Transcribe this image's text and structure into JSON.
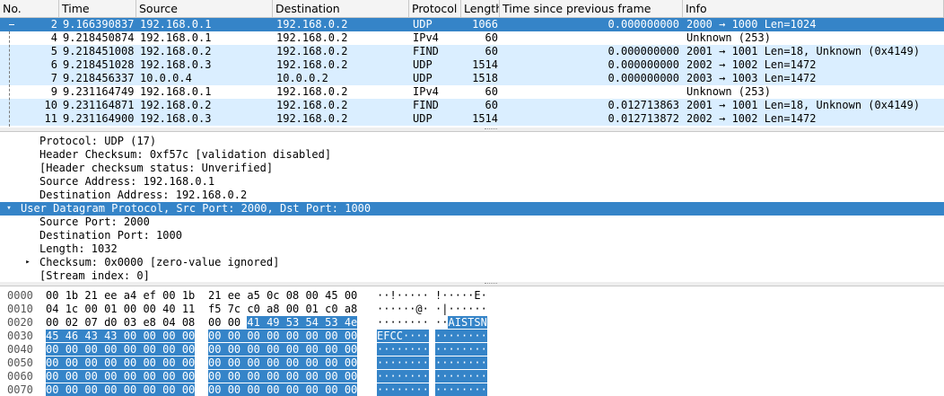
{
  "packet_list": {
    "columns": [
      "No.",
      "Time",
      "Source",
      "Destination",
      "Protocol",
      "Length",
      "Time since previous frame",
      "Info"
    ],
    "rows": [
      {
        "no": "2",
        "time": "9.166390837",
        "src": "192.168.0.1",
        "dst": "192.168.0.2",
        "proto": "UDP",
        "len": "1066",
        "delta": "0.000000000",
        "info": "2000 → 1000 Len=1024",
        "selected": true
      },
      {
        "no": "4",
        "time": "9.218450874",
        "src": "192.168.0.1",
        "dst": "192.168.0.2",
        "proto": "IPv4",
        "len": "60",
        "delta": "",
        "info": "Unknown (253)",
        "selected": false
      },
      {
        "no": "5",
        "time": "9.218451008",
        "src": "192.168.0.2",
        "dst": "192.168.0.2",
        "proto": "FIND",
        "len": "60",
        "delta": "0.000000000",
        "info": "2001 → 1001 Len=18, Unknown (0x4149)",
        "selected": false
      },
      {
        "no": "6",
        "time": "9.218451028",
        "src": "192.168.0.3",
        "dst": "192.168.0.2",
        "proto": "UDP",
        "len": "1514",
        "delta": "0.000000000",
        "info": "2002 → 1002 Len=1472",
        "selected": false
      },
      {
        "no": "7",
        "time": "9.218456337",
        "src": "10.0.0.4",
        "dst": "10.0.0.2",
        "proto": "UDP",
        "len": "1518",
        "delta": "0.000000000",
        "info": "2003 → 1003 Len=1472",
        "selected": false
      },
      {
        "no": "9",
        "time": "9.231164749",
        "src": "192.168.0.1",
        "dst": "192.168.0.2",
        "proto": "IPv4",
        "len": "60",
        "delta": "",
        "info": "Unknown (253)",
        "selected": false
      },
      {
        "no": "10",
        "time": "9.231164871",
        "src": "192.168.0.2",
        "dst": "192.168.0.2",
        "proto": "FIND",
        "len": "60",
        "delta": "0.012713863",
        "info": "2001 → 1001 Len=18, Unknown (0x4149)",
        "selected": false
      },
      {
        "no": "11",
        "time": "9.231164900",
        "src": "192.168.0.3",
        "dst": "192.168.0.2",
        "proto": "UDP",
        "len": "1514",
        "delta": "0.012713872",
        "info": "2002 → 1002 Len=1472",
        "selected": false
      }
    ]
  },
  "details": {
    "rows": [
      {
        "text": "Protocol: UDP (17)",
        "level": 1,
        "arrow": "",
        "selected": false
      },
      {
        "text": "Header Checksum: 0xf57c [validation disabled]",
        "level": 1,
        "arrow": "",
        "selected": false
      },
      {
        "text": "[Header checksum status: Unverified]",
        "level": 1,
        "arrow": "",
        "selected": false
      },
      {
        "text": "Source Address: 192.168.0.1",
        "level": 1,
        "arrow": "",
        "selected": false
      },
      {
        "text": "Destination Address: 192.168.0.2",
        "level": 1,
        "arrow": "",
        "selected": false
      },
      {
        "text": "User Datagram Protocol, Src Port: 2000, Dst Port: 1000",
        "level": 0,
        "arrow": "▾",
        "selected": true
      },
      {
        "text": "Source Port: 2000",
        "level": 1,
        "arrow": "",
        "selected": false
      },
      {
        "text": "Destination Port: 1000",
        "level": 1,
        "arrow": "",
        "selected": false
      },
      {
        "text": "Length: 1032",
        "level": 1,
        "arrow": "",
        "selected": false
      },
      {
        "text": "Checksum: 0x0000 [zero-value ignored]",
        "level": 1,
        "arrow": "▸",
        "selected": false
      },
      {
        "text": "[Stream index: 0]",
        "level": 1,
        "arrow": "",
        "selected": false
      }
    ]
  },
  "bytes": {
    "rows": [
      {
        "offset": "0000",
        "hex_a": "00 1b 21 ee a4 ef 00 1b",
        "hex_b": "21 ee a5 0c 08 00 45 00",
        "ascii_a": "··!·····",
        "ascii_b": "!·····E·",
        "hl_from": 16
      },
      {
        "offset": "0010",
        "hex_a": "04 1c 00 01 00 00 40 11",
        "hex_b": "f5 7c c0 a8 00 01 c0 a8",
        "ascii_a": "······@·",
        "ascii_b": "·|······",
        "hl_from": 16
      },
      {
        "offset": "0020",
        "hex_a": "00 02 07 d0 03 e8 04 08",
        "hex_b": "00 00 41 49 53 54 53 4e",
        "ascii_a": "········",
        "ascii_b": "··AISTSN",
        "hl_from": 10
      },
      {
        "offset": "0030",
        "hex_a": "45 46 43 43 00 00 00 00",
        "hex_b": "00 00 00 00 00 00 00 00",
        "ascii_a": "EFCC····",
        "ascii_b": "········",
        "hl_from": 0
      },
      {
        "offset": "0040",
        "hex_a": "00 00 00 00 00 00 00 00",
        "hex_b": "00 00 00 00 00 00 00 00",
        "ascii_a": "········",
        "ascii_b": "········",
        "hl_from": 0
      },
      {
        "offset": "0050",
        "hex_a": "00 00 00 00 00 00 00 00",
        "hex_b": "00 00 00 00 00 00 00 00",
        "ascii_a": "········",
        "ascii_b": "········",
        "hl_from": 0
      },
      {
        "offset": "0060",
        "hex_a": "00 00 00 00 00 00 00 00",
        "hex_b": "00 00 00 00 00 00 00 00",
        "ascii_a": "········",
        "ascii_b": "········",
        "hl_from": 0
      },
      {
        "offset": "0070",
        "hex_a": "00 00 00 00 00 00 00 00",
        "hex_b": "00 00 00 00 00 00 00 00",
        "ascii_a": "········",
        "ascii_b": "········",
        "hl_from": 0
      }
    ]
  },
  "colors": {
    "selected": "#3584c8",
    "udp_row": "#daeeff",
    "plain_row": "#ffffff"
  }
}
